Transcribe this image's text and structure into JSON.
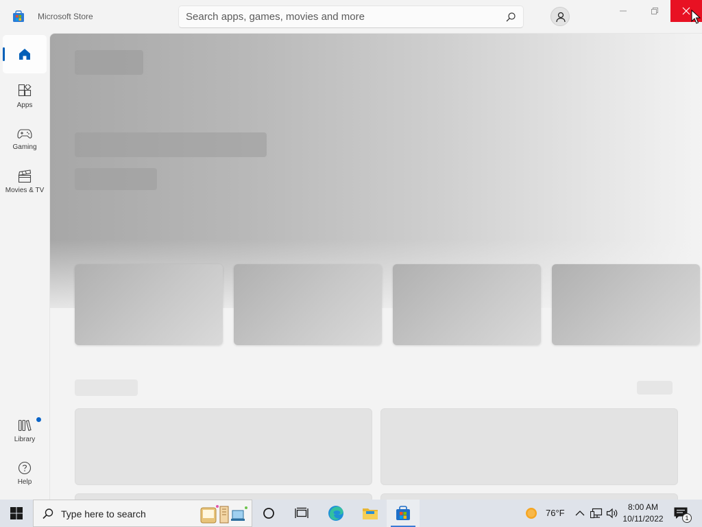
{
  "window": {
    "title": "Microsoft Store",
    "controls": {
      "minimize": "minimize",
      "maximize": "restore",
      "close": "close"
    }
  },
  "search": {
    "placeholder": "Search apps, games, movies and more",
    "value": ""
  },
  "sidebar": {
    "items": [
      {
        "id": "home",
        "label": "",
        "icon": "home-icon",
        "active": true
      },
      {
        "id": "apps",
        "label": "Apps",
        "icon": "apps-icon"
      },
      {
        "id": "gaming",
        "label": "Gaming",
        "icon": "gamepad-icon"
      },
      {
        "id": "movies",
        "label": "Movies & TV",
        "icon": "clapperboard-icon"
      }
    ],
    "bottom_items": [
      {
        "id": "library",
        "label": "Library",
        "icon": "library-icon",
        "has_badge": true
      },
      {
        "id": "help",
        "label": "Help",
        "icon": "help-icon"
      }
    ]
  },
  "main": {
    "state": "loading-skeleton",
    "hero_cards": 4,
    "section_tiles": 2
  },
  "taskbar": {
    "search_placeholder": "Type here to search",
    "pinned": [
      "task-view-icon",
      "edge-icon",
      "file-explorer-icon",
      "store-icon"
    ],
    "active_app": "store-icon",
    "weather": {
      "temp": "76°F",
      "icon": "sun-icon"
    },
    "clock": {
      "time": "8:00 AM",
      "date": "10/11/2022"
    },
    "notification_count": "1"
  },
  "colors": {
    "accent": "#005fb8",
    "close_hover": "#e81123",
    "background": "#f3f3f3"
  }
}
